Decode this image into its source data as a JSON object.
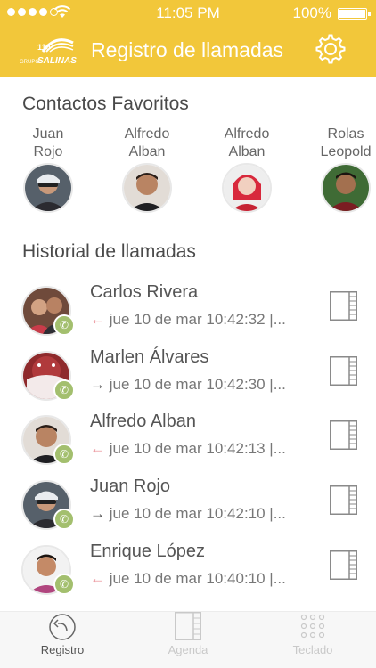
{
  "status_bar": {
    "time": "11:05 PM",
    "battery": "100%"
  },
  "header": {
    "title": "Registro de llamadas",
    "logo_top": "110",
    "logo_bottom": "GRUPO SALINAS"
  },
  "favorites": {
    "title": "Contactos Favoritos",
    "items": [
      {
        "first": "Juan",
        "last": "Rojo"
      },
      {
        "first": "Alfredo",
        "last": "Alban"
      },
      {
        "first": "Alfredo",
        "last": "Alban"
      },
      {
        "first": "Rolas",
        "last": "Leopold"
      }
    ]
  },
  "history": {
    "title": "Historial de llamadas",
    "items": [
      {
        "name": "Carlos Rivera",
        "direction": "incoming",
        "arrow": "←",
        "detail": " jue 10 de mar 10:42:32 |..."
      },
      {
        "name": "Marlen Álvares",
        "direction": "outgoing",
        "arrow": "→",
        "detail": " jue 10 de mar 10:42:30 |..."
      },
      {
        "name": "Alfredo Alban",
        "direction": "incoming",
        "arrow": "←",
        "detail": " jue 10 de mar 10:42:13 |..."
      },
      {
        "name": "Juan Rojo",
        "direction": "outgoing",
        "arrow": "→",
        "detail": " jue 10 de mar 10:42:10 |..."
      },
      {
        "name": "Enrique López",
        "direction": "incoming",
        "arrow": "←",
        "detail": " jue 10 de mar 10:40:10 |..."
      }
    ]
  },
  "tabs": [
    {
      "label": "Registro",
      "icon": "history-icon",
      "active": true
    },
    {
      "label": "Agenda",
      "icon": "agenda-icon",
      "active": false
    },
    {
      "label": "Teclado",
      "icon": "keypad-icon",
      "active": false
    }
  ],
  "colors": {
    "header": "#f2c73a",
    "badge": "#a3bf6e",
    "incoming_arrow": "#e7818a"
  }
}
